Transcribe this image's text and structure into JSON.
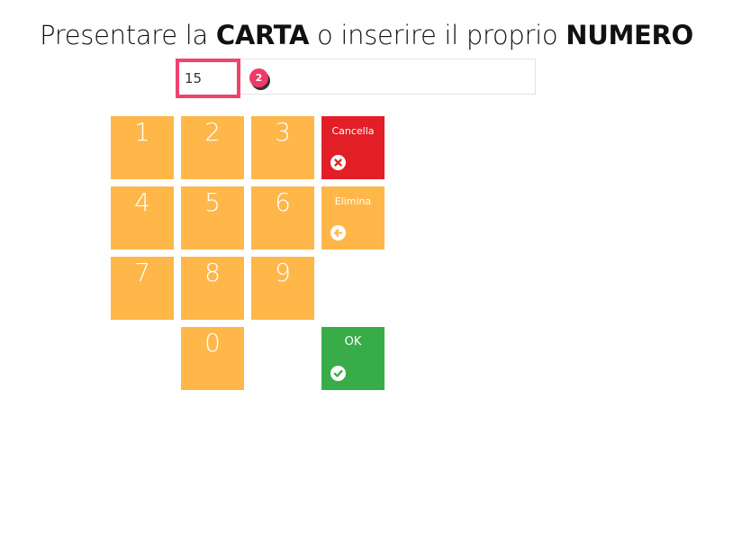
{
  "header": {
    "title_part1": "Presentare la ",
    "title_bold1": "CARTA",
    "title_part2": " o inserire il proprio ",
    "title_bold2": "NUMERO"
  },
  "card_input": {
    "value": "15",
    "step_badge": "2"
  },
  "keypad": {
    "keys": [
      "1",
      "2",
      "3",
      "4",
      "5",
      "6",
      "7",
      "8",
      "9",
      "0"
    ]
  },
  "actions": {
    "cancel_label": "Cancella",
    "cancel_icon": "close-circle-icon",
    "delete_label": "Elimina",
    "delete_icon": "arrow-left-circle-icon",
    "ok_label": "OK",
    "ok_icon": "check-circle-icon"
  },
  "colors": {
    "key": "#ffb74a",
    "cancel": "#e21f26",
    "ok": "#39ac4a",
    "highlight": "#f0426b"
  }
}
